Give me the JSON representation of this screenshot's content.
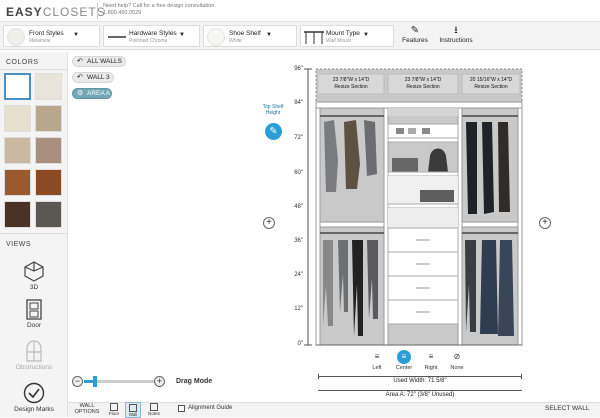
{
  "header": {
    "logo_main": "EASY",
    "logo_sub": "CLOSETS",
    "help_line1": "Need help? Call for a free design consultation.",
    "help_line2": "1.800.450.0529"
  },
  "options": [
    {
      "title": "Front Styles",
      "sub": "Melamine"
    },
    {
      "title": "Hardware Styles",
      "sub": "Polished Chrome"
    },
    {
      "title": "Shoe Shelf",
      "sub": "White"
    },
    {
      "title": "Mount Type",
      "sub": "Wall Mount"
    }
  ],
  "tools": {
    "features": "Features",
    "instructions": "Instructions"
  },
  "left": {
    "colors_head": "COLORS",
    "views_head": "VIEWS",
    "views": [
      "3D",
      "Door",
      "Obstructions",
      "Design Marks"
    ],
    "swatch_colors": [
      "#ffffff",
      "#e8e4da",
      "#e6e1cf",
      "#b8a78d",
      "#c9b9a0",
      "#a98f80",
      "#9b5a2e",
      "#8a4a24",
      "#4a3326",
      "#5b5753"
    ]
  },
  "walls": {
    "all": "ALL WALLS",
    "wall3": "WALL 3",
    "area": "AREA A"
  },
  "drawing": {
    "top_shelf": "Top Shelf Height",
    "sections": [
      {
        "dim": "23 7/8\"W x 14\"D",
        "label": "Resize Section"
      },
      {
        "dim": "23 7/8\"W x 14\"D",
        "label": "Resize Section"
      },
      {
        "dim": "20 15/16\"W x 14\"D",
        "label": "Resize Section"
      }
    ],
    "ruler": [
      "96\"",
      "84\"",
      "72\"",
      "60\"",
      "48\"",
      "36\"",
      "24\"",
      "12\"",
      "0\""
    ],
    "used_width": "Used Width: 71 5/8\"",
    "area_width": "Area A: 72\" (3/8\" Unused)"
  },
  "align": [
    {
      "label": "Left"
    },
    {
      "label": "Center"
    },
    {
      "label": "Right"
    },
    {
      "label": "None"
    }
  ],
  "zoom": {
    "label": "Drag Mode",
    "level": 0.15
  },
  "bottom": {
    "wall_options": "WALL OPTIONS",
    "floor": "Floor",
    "wall": "Wall",
    "notes": "Notes",
    "alignment_guide": "Alignment Guide",
    "select_wall": "SELECT WALL"
  },
  "colors": {
    "accent": "#2a9fd6",
    "area": "#73a7b7",
    "wall_bg": "#c9c9c9",
    "panel": "#ffffff"
  }
}
